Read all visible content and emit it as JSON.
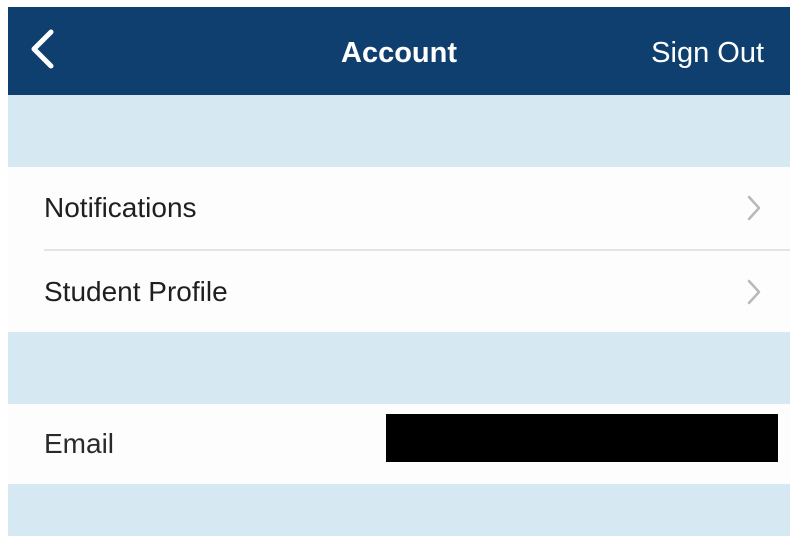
{
  "navbar": {
    "back_icon": "chevron-left-icon",
    "title": "Account",
    "sign_out_label": "Sign Out",
    "background": "#0f3f6e",
    "text_color": "#ffffff"
  },
  "settings_group": {
    "items": [
      {
        "label": "Notifications",
        "icon": "chevron-right-icon"
      },
      {
        "label": "Student Profile",
        "icon": "chevron-right-icon"
      }
    ]
  },
  "account_info": {
    "email_label": "Email",
    "email_value": "",
    "email_value_redacted": true
  },
  "colors": {
    "page_background": "#d6e8f2",
    "row_background": "#fdfdfd",
    "chevron": "#b8b8b8"
  }
}
